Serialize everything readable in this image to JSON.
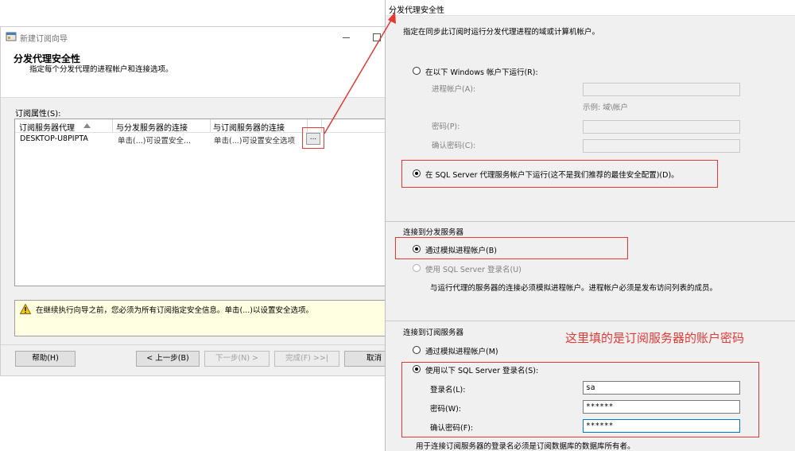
{
  "wizard": {
    "title": "新建订阅向导",
    "heading": "分发代理安全性",
    "subtitle": "指定每个分发代理的进程帐户和连接选项。",
    "grid_label": "订阅属性(S):",
    "columns": [
      "订阅服务器代理",
      "与分发服务器的连接",
      "与订阅服务器的连接"
    ],
    "rows": [
      {
        "agent": "DESKTOP-U8PIPTA",
        "dist": "单击(...)可设置安全...",
        "sub": "单击(...)可设置安全选项",
        "ellipsis": "..."
      }
    ],
    "warning": "在继续执行向导之前，您必须为所有订阅指定安全信息。单击(...)以设置安全选项。",
    "buttons": {
      "help": "帮助(H)",
      "back": "< 上一步(B)",
      "next": "下一步(N) >",
      "finish": "完成(F) >>|",
      "cancel": "取消"
    }
  },
  "dialog": {
    "title": "分发代理安全性",
    "intro": "指定在同步此订阅时运行分发代理进程的域或计算机帐户。",
    "opt_windows": "在以下 Windows 帐户下运行(R):",
    "process_account": "进程帐户(A):",
    "example": "示例: 域\\帐户",
    "password": "密码(P):",
    "confirm_password": "确认密码(C):",
    "opt_sqlagent": "在 SQL Server 代理服务帐户下运行(这不是我们推荐的最佳安全配置)(D)。",
    "dist_section": "连接到分发服务器",
    "dist_impersonate": "通过模拟进程帐户(B)",
    "dist_sql_login": "使用 SQL Server 登录名(U)",
    "dist_note": "与运行代理的服务器的连接必须模拟进程帐户。进程帐户必须是发布访问列表的成员。",
    "sub_section": "连接到订阅服务器",
    "sub_impersonate": "通过模拟进程帐户(M)",
    "sub_sql_login": "使用以下 SQL Server 登录名(S):",
    "login_label": "登录名(L):",
    "login_value": "sa",
    "sub_password_label": "密码(W):",
    "sub_password_value": "******",
    "sub_confirm_label": "确认密码(F):",
    "sub_confirm_value": "******",
    "sub_note": "用于连接订阅服务器的登录名必须是订阅数据库的数据库所有者。"
  },
  "annotation": {
    "text": "这里填的是订阅服务器的账户密码",
    "color": "#e53935"
  }
}
